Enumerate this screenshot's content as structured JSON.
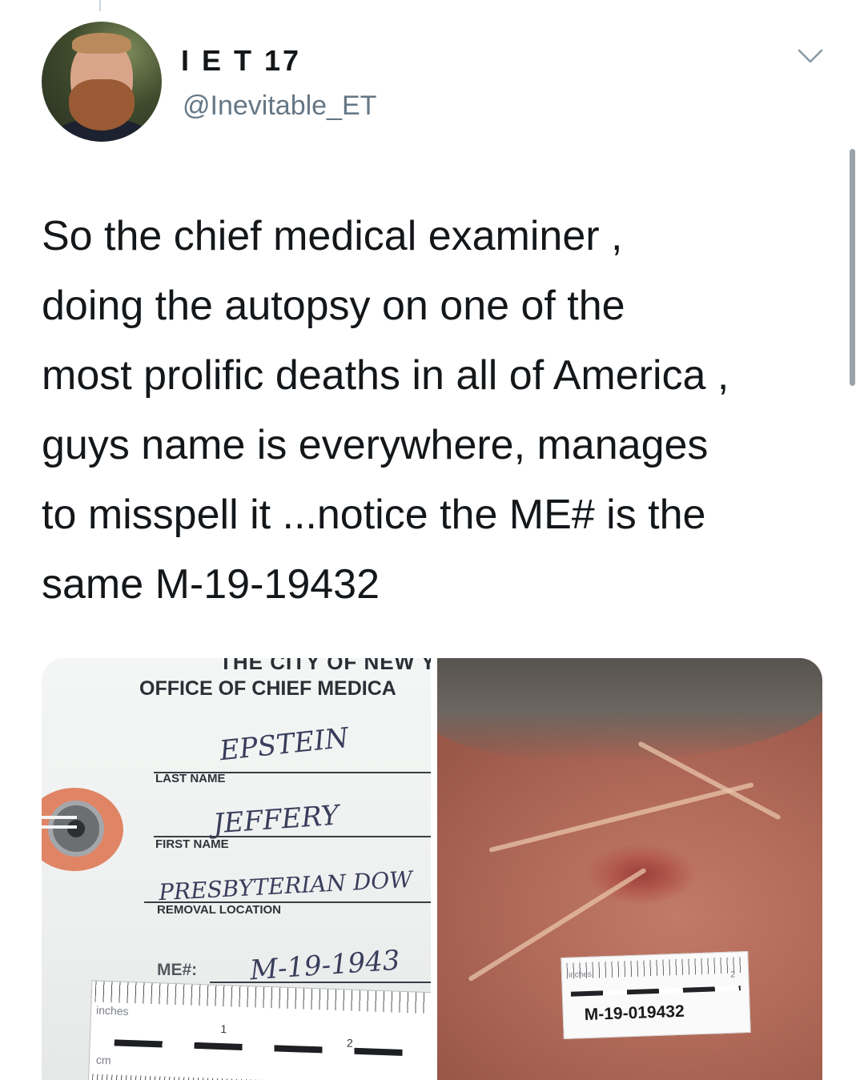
{
  "user": {
    "display_name": "I E T 17",
    "handle": "@Inevitable_ET"
  },
  "tweet": {
    "text": "So the chief medical examiner ,\ndoing the autopsy on one of the\nmost prolific deaths in all of America ,\nguys name is everywhere, manages\nto misspell it ...notice the ME# is the\nsame M-19-19432"
  },
  "media": {
    "tag_photo": {
      "header_city": "THE CITY OF NEW Y",
      "header_office": "OFFICE OF CHIEF MEDICA",
      "last_name_label": "LAST NAME",
      "last_name_value": "EPSTEIN",
      "first_name_label": "FIRST NAME",
      "first_name_value": "JEFFERY",
      "removal_label": "REMOVAL LOCATION",
      "removal_value": "PRESBYTERIAN DOW",
      "me_label": "ME#:",
      "me_value": "M-19-1943",
      "ruler_unit_inches": "inches",
      "ruler_unit_cm": "cm",
      "ruler_num_1": "1",
      "ruler_num_2": "2"
    },
    "neck_photo": {
      "ruler_unit": "inches",
      "ruler_num": "2",
      "me_number": "M-19-019432"
    }
  },
  "icons": {
    "menu": "chevron-down-icon"
  },
  "colors": {
    "text": "#14171a",
    "secondary": "#657786"
  }
}
